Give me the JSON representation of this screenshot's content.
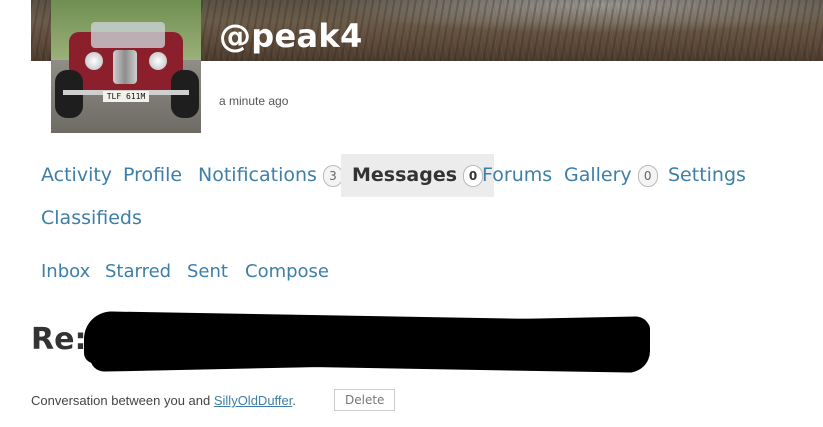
{
  "profile": {
    "username": "@peak4",
    "last_active": "a minute ago",
    "avatar_plate": "TLF 611M"
  },
  "nav": {
    "items": [
      {
        "label": "Activity"
      },
      {
        "label": "Profile"
      },
      {
        "label": "Notifications",
        "count": "3"
      },
      {
        "label": "Messages",
        "count": "0",
        "active": true
      },
      {
        "label": "Forums"
      },
      {
        "label": "Gallery",
        "count": "0"
      },
      {
        "label": "Settings"
      },
      {
        "label": "Classifieds"
      }
    ]
  },
  "subnav": {
    "items": [
      {
        "label": "Inbox"
      },
      {
        "label": "Starred"
      },
      {
        "label": "Sent"
      },
      {
        "label": "Compose"
      }
    ]
  },
  "thread": {
    "title_prefix": "Re:",
    "conversation_text": "Conversation between you and",
    "participant": "SillyOldDuffer",
    "period": ".",
    "delete_label": "Delete"
  },
  "colors": {
    "link": "#3d7fa8",
    "active_tab_bg": "#ececec"
  }
}
